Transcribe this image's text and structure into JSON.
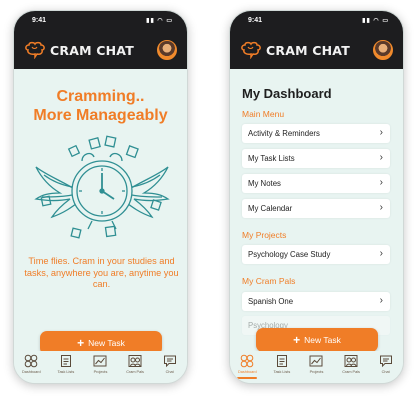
{
  "left_screen": {
    "status_time": "9:41",
    "brand": "CRAM CHAT",
    "hero_title_line1": "Cramming..",
    "hero_title_line2": "More Manageably",
    "hero_body": "Time flies. Cram in your studies and tasks, anywhere you are, anytime you can.",
    "cta_label": "New Task",
    "tabs": [
      {
        "label": "Dashboard",
        "icon": "grid-circles-icon"
      },
      {
        "label": "Task Lists",
        "icon": "notepad-icon"
      },
      {
        "label": "Projects",
        "icon": "trend-chart-icon"
      },
      {
        "label": "Cram Pals",
        "icon": "people-icon"
      },
      {
        "label": "Chat",
        "icon": "chat-bubble-icon"
      }
    ]
  },
  "right_screen": {
    "status_time": "9:41",
    "brand": "CRAM CHAT",
    "title": "My Dashboard",
    "main_menu_label": "Main Menu",
    "main_menu": [
      "Activity & Reminders",
      "My Task Lists",
      "My Notes",
      "My Calendar"
    ],
    "projects_label": "My Projects",
    "projects": [
      "Psychology Case Study"
    ],
    "pals_label": "My Cram Pals",
    "pals": [
      "Spanish One",
      "Psychology"
    ],
    "cta_label": "New Task",
    "active_tab": "Dashboard",
    "tabs": [
      {
        "label": "Dashboard",
        "icon": "grid-circles-icon"
      },
      {
        "label": "Task Lists",
        "icon": "notepad-icon"
      },
      {
        "label": "Projects",
        "icon": "trend-chart-icon"
      },
      {
        "label": "Cram Pals",
        "icon": "people-icon"
      },
      {
        "label": "Chat",
        "icon": "chat-bubble-icon"
      }
    ]
  },
  "colors": {
    "accent": "#f07d27",
    "appbar": "#1d1d1f",
    "screen_bg": "#e8f4f1",
    "illustration": "#2f8f93"
  }
}
